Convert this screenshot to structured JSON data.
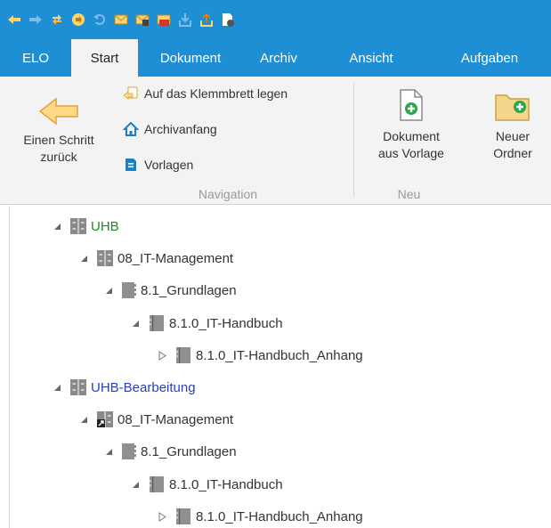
{
  "quick_access": {
    "icons": [
      "back-arrow-icon",
      "forward-arrow-icon",
      "refresh-icon",
      "navigate-icon",
      "undo-icon",
      "mail-icon",
      "mail-link-icon",
      "mail-pdf-icon",
      "checkout-icon",
      "checkin-icon",
      "document-properties-icon"
    ]
  },
  "tabs": [
    {
      "label": "ELO"
    },
    {
      "label": "Start"
    },
    {
      "label": "Dokument"
    },
    {
      "label": "Archiv"
    },
    {
      "label": "Ansicht"
    },
    {
      "label": "Aufgaben"
    }
  ],
  "active_tab": "Start",
  "ribbon": {
    "navigation": {
      "label": "Navigation",
      "back_line1": "Einen Schritt",
      "back_line2": "zurück",
      "clipboard": "Auf das Klemmbrett legen",
      "archive_start": "Archivanfang",
      "templates": "Vorlagen"
    },
    "neu": {
      "label": "Neu",
      "doc_line1": "Dokument",
      "doc_line2": "aus Vorlage",
      "folder_line1": "Neuer",
      "folder_line2": "Ordner"
    }
  },
  "tree": [
    {
      "label": "UHB",
      "level": 0,
      "toggle": "expanded",
      "icon": "cabinet-icon",
      "color": "green"
    },
    {
      "label": "08_IT-Management",
      "level": 1,
      "toggle": "expanded",
      "icon": "cabinet-icon",
      "color": "default"
    },
    {
      "label": "8.1_Grundlagen",
      "level": 2,
      "toggle": "expanded",
      "icon": "folder-icon",
      "color": "default"
    },
    {
      "label": "8.1.0_IT-Handbuch",
      "level": 3,
      "toggle": "expanded",
      "icon": "register-icon",
      "color": "default"
    },
    {
      "label": "8.1.0_IT-Handbuch_Anhang",
      "level": 4,
      "toggle": "collapsed",
      "icon": "register-icon",
      "color": "default"
    },
    {
      "label": "UHB-Bearbeitung",
      "level": 0,
      "toggle": "expanded",
      "icon": "cabinet-icon",
      "color": "blue"
    },
    {
      "label": "08_IT-Management",
      "level": 1,
      "toggle": "expanded",
      "icon": "cabinet-reference-icon",
      "color": "default"
    },
    {
      "label": "8.1_Grundlagen",
      "level": 2,
      "toggle": "expanded",
      "icon": "folder-icon",
      "color": "default"
    },
    {
      "label": "8.1.0_IT-Handbuch",
      "level": 3,
      "toggle": "expanded",
      "icon": "register-icon",
      "color": "default"
    },
    {
      "label": "8.1.0_IT-Handbuch_Anhang",
      "level": 4,
      "toggle": "collapsed",
      "icon": "register-icon",
      "color": "default"
    }
  ],
  "colors": {
    "header_blue": "#1e8fd5",
    "ribbon_bg": "#f3f3f3",
    "label_green": "#1a8a2a",
    "label_blue": "#2a3fc4",
    "new_icon_green": "#2aa84a"
  }
}
